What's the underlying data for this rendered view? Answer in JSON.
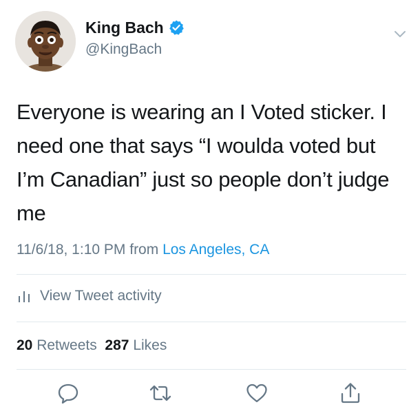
{
  "user": {
    "display_name": "King Bach",
    "handle": "@KingBach",
    "verified": true
  },
  "tweet": {
    "text": "Everyone is wearing an I Voted sticker. I need one that says “I woulda voted but I’m Canadian” just so people don’t judge me",
    "timestamp": "11/6/18, 1:10 PM",
    "from_word": "from",
    "location": "Los Angeles, CA"
  },
  "activity": {
    "label": "View Tweet activity"
  },
  "stats": {
    "retweets_count": "20",
    "retweets_label": "Retweets",
    "likes_count": "287",
    "likes_label": "Likes"
  },
  "icons": {
    "verified": "verified-badge-icon",
    "menu": "chevron-down-icon",
    "activity": "bar-chart-icon",
    "reply": "reply-icon",
    "retweet": "retweet-icon",
    "like": "heart-icon",
    "share": "share-icon"
  },
  "colors": {
    "text": "#14171a",
    "secondary": "#657786",
    "link": "#1b95e0",
    "verified": "#1da1f2",
    "divider": "#e1e8ed"
  }
}
